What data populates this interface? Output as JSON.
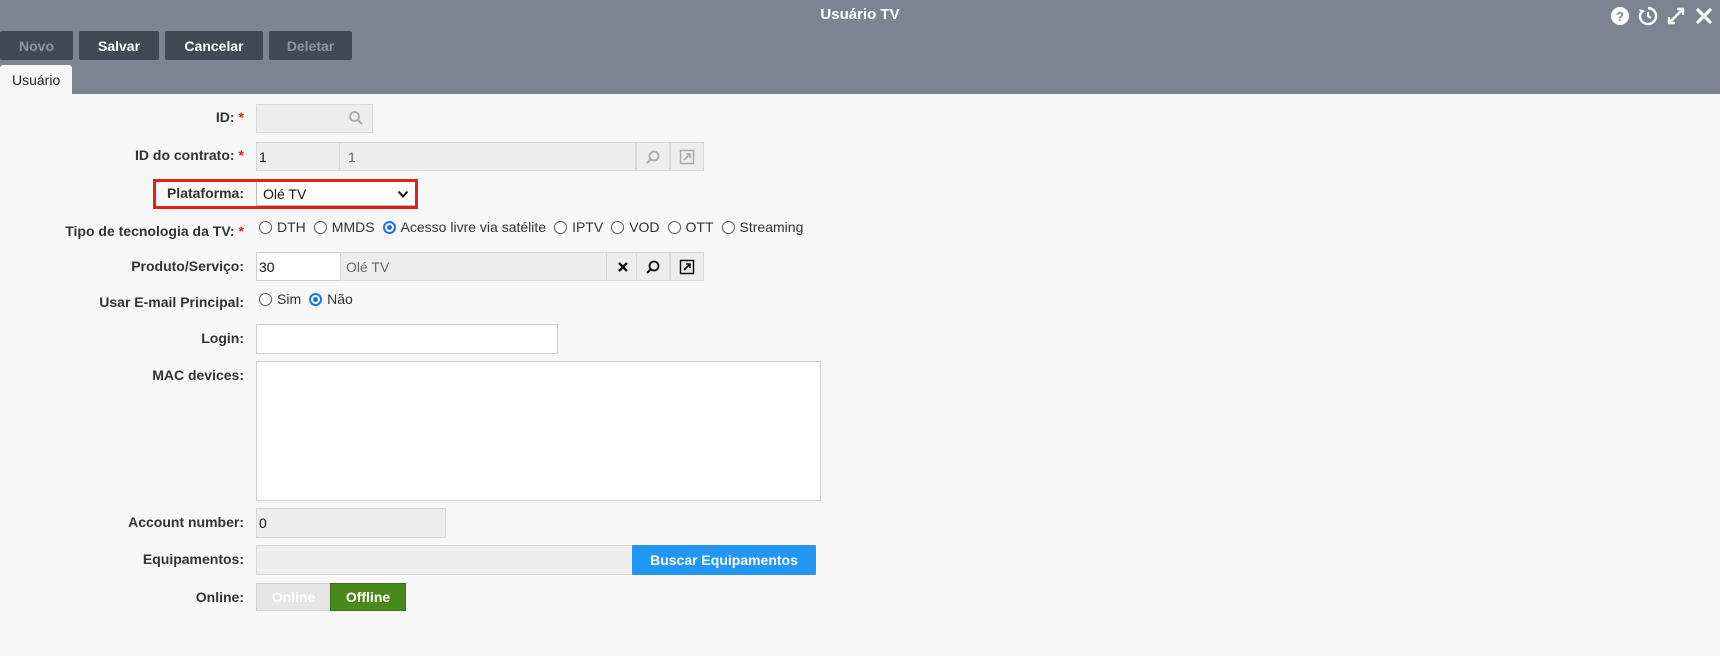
{
  "window": {
    "title": "Usuário TV",
    "icons": [
      "help-icon",
      "history-icon",
      "expand-icon",
      "close-icon"
    ]
  },
  "toolbar": {
    "new_label": "Novo",
    "save_label": "Salvar",
    "cancel_label": "Cancelar",
    "delete_label": "Deletar"
  },
  "tabs": [
    {
      "label": "Usuário"
    }
  ],
  "form": {
    "id": {
      "label": "ID:",
      "required": "*",
      "value": ""
    },
    "contract": {
      "label": "ID do contrato:",
      "required": "*",
      "value": "1",
      "description": "1"
    },
    "platform": {
      "label": "Plataforma:",
      "value": "Olé TV"
    },
    "tech": {
      "label": "Tipo de tecnologia da TV:",
      "required": "*",
      "options": [
        "DTH",
        "MMDS",
        "Acesso livre via satélite",
        "IPTV",
        "VOD",
        "OTT",
        "Streaming"
      ],
      "selected": "Acesso livre via satélite"
    },
    "product": {
      "label": "Produto/Serviço:",
      "value": "30",
      "description": "Olé TV"
    },
    "email": {
      "label": "Usar E-mail Principal:",
      "options": [
        "Sim",
        "Não"
      ],
      "selected": "Não"
    },
    "login": {
      "label": "Login:",
      "value": ""
    },
    "mac": {
      "label": "MAC devices:",
      "value": ""
    },
    "account": {
      "label": "Account number:",
      "value": "0"
    },
    "equipment": {
      "label": "Equipamentos:",
      "value": "",
      "button": "Buscar Equipamentos"
    },
    "online": {
      "label": "Online:",
      "options": [
        "Online",
        "Offline"
      ],
      "selected": "Offline"
    }
  },
  "colors": {
    "header": "#7b8490",
    "toolbar_button": "#3f4a55",
    "accent_blue": "#2196f3",
    "required": "#e0201a",
    "toggle_active": "#4a8a1c",
    "highlight": "#e0201a"
  }
}
